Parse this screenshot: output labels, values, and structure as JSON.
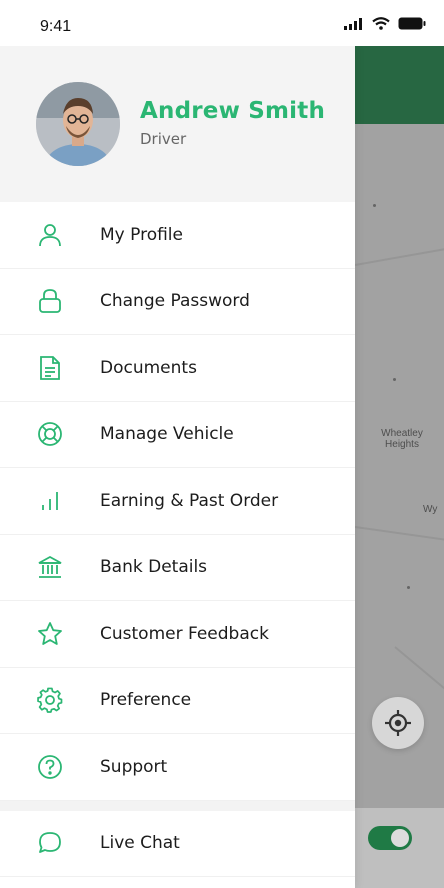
{
  "status_bar": {
    "time": "9:41"
  },
  "profile": {
    "name": "Andrew Smith",
    "role": "Driver"
  },
  "menu": [
    {
      "label": "My Profile",
      "icon": "user-icon"
    },
    {
      "label": "Change Password",
      "icon": "lock-icon"
    },
    {
      "label": "Documents",
      "icon": "document-icon"
    },
    {
      "label": "Manage Vehicle",
      "icon": "lifebuoy-icon"
    },
    {
      "label": "Earning & Past Order",
      "icon": "bar-chart-icon"
    },
    {
      "label": "Bank Details",
      "icon": "bank-icon"
    },
    {
      "label": "Customer Feedback",
      "icon": "star-icon"
    },
    {
      "label": "Preference",
      "icon": "gear-icon"
    },
    {
      "label": "Support",
      "icon": "help-icon"
    },
    {
      "label": "Live Chat",
      "icon": "chat-icon"
    }
  ],
  "map": {
    "place_labels": [
      "Wheatley Heights",
      "Wy"
    ]
  },
  "colors": {
    "accent": "#2bb673",
    "header_green": "#1f7a45"
  }
}
